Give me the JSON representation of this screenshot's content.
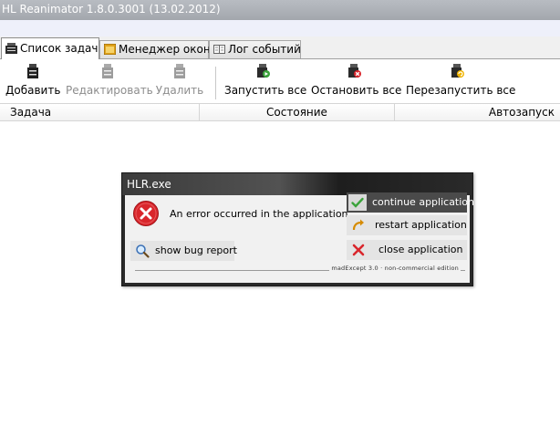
{
  "window": {
    "title": "HL Reanimator 1.8.0.3001 (13.02.2012)"
  },
  "tabs": [
    {
      "label": "Список задач",
      "icon": "task-list-icon",
      "active": true
    },
    {
      "label": "Менеджер окон",
      "icon": "window-manager-icon",
      "active": false
    },
    {
      "label": "Лог событий",
      "icon": "event-log-icon",
      "active": false
    }
  ],
  "toolbar": {
    "add_label": "Добавить",
    "edit_label": "Редактировать",
    "delete_label": "Удалить",
    "start_all_label": "Запустить все",
    "stop_all_label": "Остановить все",
    "restart_all_label": "Перезапустить все"
  },
  "grid": {
    "columns": [
      "Задача",
      "Состояние",
      "Автозапуск"
    ],
    "rows": []
  },
  "dialog": {
    "title": "HLR.exe",
    "message": "An error occurred in the application.",
    "show_bug_report_label": "show bug report",
    "continue_label": "continue application",
    "restart_label": "restart application",
    "close_label": "close application",
    "footer": "madExcept 3.0 · non-commercial edition",
    "error_color": "#d9262c",
    "continue_icon_color": "#3ba33b"
  }
}
